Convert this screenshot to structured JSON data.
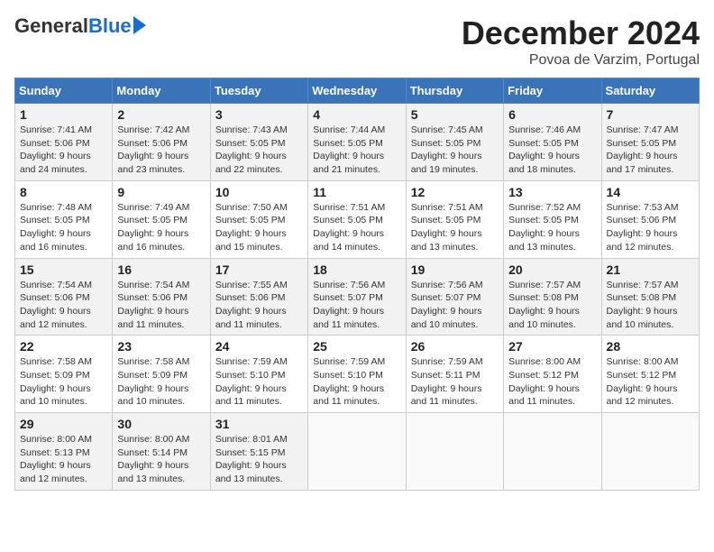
{
  "header": {
    "logo_general": "General",
    "logo_blue": "Blue",
    "month_title": "December 2024",
    "location": "Povoa de Varzim, Portugal"
  },
  "calendar": {
    "days_of_week": [
      "Sunday",
      "Monday",
      "Tuesday",
      "Wednesday",
      "Thursday",
      "Friday",
      "Saturday"
    ],
    "weeks": [
      [
        {
          "day": "",
          "detail": ""
        },
        {
          "day": "",
          "detail": ""
        },
        {
          "day": "",
          "detail": ""
        },
        {
          "day": "",
          "detail": ""
        },
        {
          "day": "",
          "detail": ""
        },
        {
          "day": "",
          "detail": ""
        },
        {
          "day": "",
          "detail": ""
        }
      ],
      [
        {
          "day": "1",
          "detail": "Sunrise: 7:41 AM\nSunset: 5:06 PM\nDaylight: 9 hours\nand 24 minutes."
        },
        {
          "day": "2",
          "detail": "Sunrise: 7:42 AM\nSunset: 5:06 PM\nDaylight: 9 hours\nand 23 minutes."
        },
        {
          "day": "3",
          "detail": "Sunrise: 7:43 AM\nSunset: 5:05 PM\nDaylight: 9 hours\nand 22 minutes."
        },
        {
          "day": "4",
          "detail": "Sunrise: 7:44 AM\nSunset: 5:05 PM\nDaylight: 9 hours\nand 21 minutes."
        },
        {
          "day": "5",
          "detail": "Sunrise: 7:45 AM\nSunset: 5:05 PM\nDaylight: 9 hours\nand 19 minutes."
        },
        {
          "day": "6",
          "detail": "Sunrise: 7:46 AM\nSunset: 5:05 PM\nDaylight: 9 hours\nand 18 minutes."
        },
        {
          "day": "7",
          "detail": "Sunrise: 7:47 AM\nSunset: 5:05 PM\nDaylight: 9 hours\nand 17 minutes."
        }
      ],
      [
        {
          "day": "8",
          "detail": "Sunrise: 7:48 AM\nSunset: 5:05 PM\nDaylight: 9 hours\nand 16 minutes."
        },
        {
          "day": "9",
          "detail": "Sunrise: 7:49 AM\nSunset: 5:05 PM\nDaylight: 9 hours\nand 16 minutes."
        },
        {
          "day": "10",
          "detail": "Sunrise: 7:50 AM\nSunset: 5:05 PM\nDaylight: 9 hours\nand 15 minutes."
        },
        {
          "day": "11",
          "detail": "Sunrise: 7:51 AM\nSunset: 5:05 PM\nDaylight: 9 hours\nand 14 minutes."
        },
        {
          "day": "12",
          "detail": "Sunrise: 7:51 AM\nSunset: 5:05 PM\nDaylight: 9 hours\nand 13 minutes."
        },
        {
          "day": "13",
          "detail": "Sunrise: 7:52 AM\nSunset: 5:05 PM\nDaylight: 9 hours\nand 13 minutes."
        },
        {
          "day": "14",
          "detail": "Sunrise: 7:53 AM\nSunset: 5:06 PM\nDaylight: 9 hours\nand 12 minutes."
        }
      ],
      [
        {
          "day": "15",
          "detail": "Sunrise: 7:54 AM\nSunset: 5:06 PM\nDaylight: 9 hours\nand 12 minutes."
        },
        {
          "day": "16",
          "detail": "Sunrise: 7:54 AM\nSunset: 5:06 PM\nDaylight: 9 hours\nand 11 minutes."
        },
        {
          "day": "17",
          "detail": "Sunrise: 7:55 AM\nSunset: 5:06 PM\nDaylight: 9 hours\nand 11 minutes."
        },
        {
          "day": "18",
          "detail": "Sunrise: 7:56 AM\nSunset: 5:07 PM\nDaylight: 9 hours\nand 11 minutes."
        },
        {
          "day": "19",
          "detail": "Sunrise: 7:56 AM\nSunset: 5:07 PM\nDaylight: 9 hours\nand 10 minutes."
        },
        {
          "day": "20",
          "detail": "Sunrise: 7:57 AM\nSunset: 5:08 PM\nDaylight: 9 hours\nand 10 minutes."
        },
        {
          "day": "21",
          "detail": "Sunrise: 7:57 AM\nSunset: 5:08 PM\nDaylight: 9 hours\nand 10 minutes."
        }
      ],
      [
        {
          "day": "22",
          "detail": "Sunrise: 7:58 AM\nSunset: 5:09 PM\nDaylight: 9 hours\nand 10 minutes."
        },
        {
          "day": "23",
          "detail": "Sunrise: 7:58 AM\nSunset: 5:09 PM\nDaylight: 9 hours\nand 10 minutes."
        },
        {
          "day": "24",
          "detail": "Sunrise: 7:59 AM\nSunset: 5:10 PM\nDaylight: 9 hours\nand 11 minutes."
        },
        {
          "day": "25",
          "detail": "Sunrise: 7:59 AM\nSunset: 5:10 PM\nDaylight: 9 hours\nand 11 minutes."
        },
        {
          "day": "26",
          "detail": "Sunrise: 7:59 AM\nSunset: 5:11 PM\nDaylight: 9 hours\nand 11 minutes."
        },
        {
          "day": "27",
          "detail": "Sunrise: 8:00 AM\nSunset: 5:12 PM\nDaylight: 9 hours\nand 11 minutes."
        },
        {
          "day": "28",
          "detail": "Sunrise: 8:00 AM\nSunset: 5:12 PM\nDaylight: 9 hours\nand 12 minutes."
        }
      ],
      [
        {
          "day": "29",
          "detail": "Sunrise: 8:00 AM\nSunset: 5:13 PM\nDaylight: 9 hours\nand 12 minutes."
        },
        {
          "day": "30",
          "detail": "Sunrise: 8:00 AM\nSunset: 5:14 PM\nDaylight: 9 hours\nand 13 minutes."
        },
        {
          "day": "31",
          "detail": "Sunrise: 8:01 AM\nSunset: 5:15 PM\nDaylight: 9 hours\nand 13 minutes."
        },
        {
          "day": "",
          "detail": ""
        },
        {
          "day": "",
          "detail": ""
        },
        {
          "day": "",
          "detail": ""
        },
        {
          "day": "",
          "detail": ""
        }
      ]
    ]
  }
}
